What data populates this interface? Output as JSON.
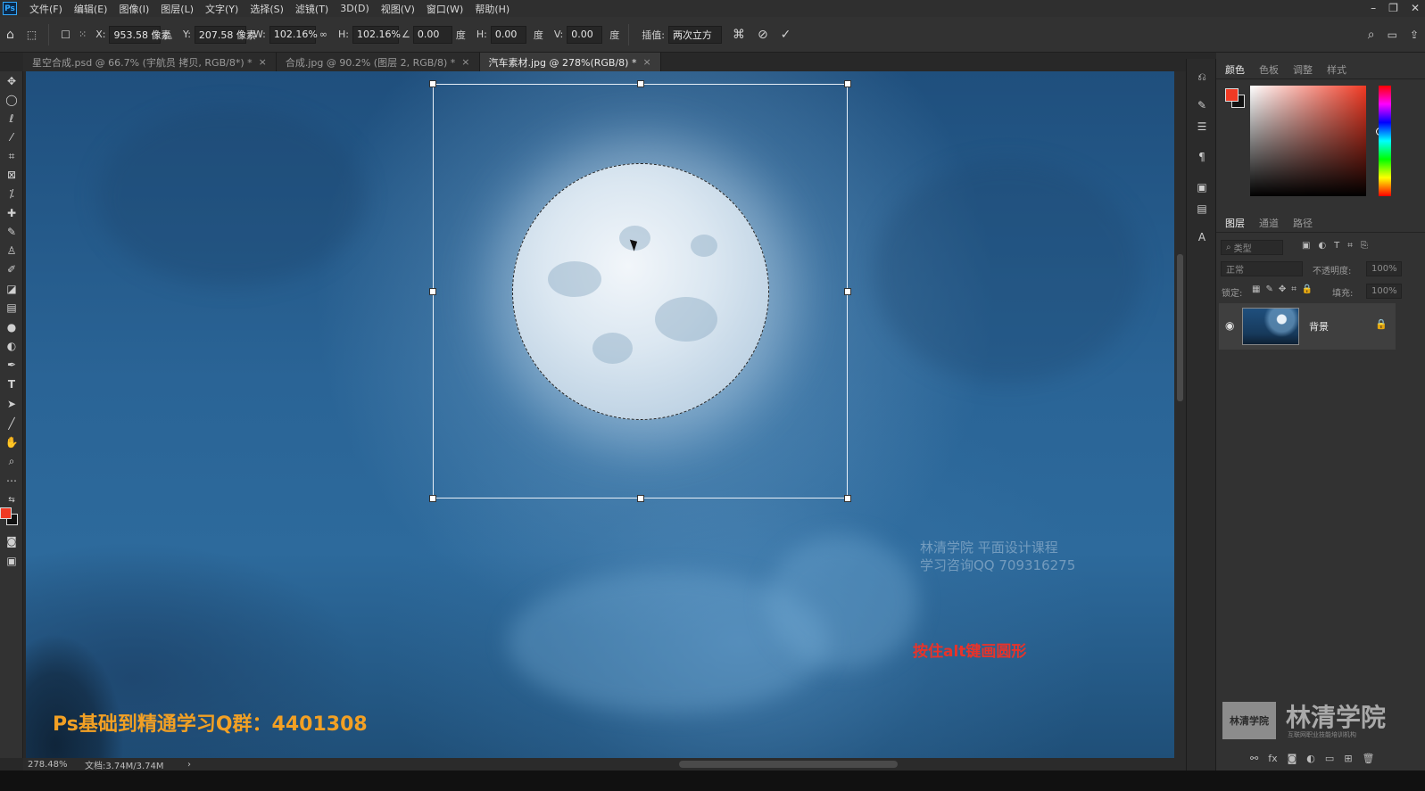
{
  "app": {
    "logo": "Ps",
    "menu": [
      "文件(F)",
      "编辑(E)",
      "图像(I)",
      "图层(L)",
      "文字(Y)",
      "选择(S)",
      "滤镜(T)",
      "3D(D)",
      "视图(V)",
      "窗口(W)",
      "帮助(H)"
    ],
    "window_controls": [
      "–",
      "❐",
      "✕"
    ]
  },
  "options": {
    "x_label": "X:",
    "x_value": "953.58 像素",
    "y_label": "Y:",
    "y_value": "207.58 像素",
    "w_label": "W:",
    "w_value": "102.16%",
    "h_label": "H:",
    "h_value": "102.16%",
    "angle_value": "0.00",
    "angle_unit": "度",
    "hskew_label": "H:",
    "hskew_value": "0.00",
    "hskew_unit": "度",
    "vskew_label": "V:",
    "vskew_value": "0.00",
    "vskew_unit": "度",
    "interp_label": "插值:",
    "interp_value": "两次立方"
  },
  "tabs": [
    {
      "label": "星空合成.psd @ 66.7% (宇航员 拷贝, RGB/8*) *",
      "close": "×"
    },
    {
      "label": "合成.jpg @ 90.2% (图层 2, RGB/8) *",
      "close": "×"
    },
    {
      "label": "汽车素材.jpg @ 278%(RGB/8) *",
      "close": "×"
    }
  ],
  "canvas": {
    "watermark_line1": "林清学院  平面设计课程",
    "watermark_line2": "学习咨询QQ 709316275",
    "red_note": "按住alt键画圆形",
    "orange_note": "Ps基础到精通学习Q群：4401308"
  },
  "status": {
    "zoom": "278.48%",
    "doc": "文档:3.74M/3.74M",
    "arrow": "›"
  },
  "color_panel": {
    "tabs": [
      "颜色",
      "色板",
      "调整",
      "样式"
    ],
    "foreground": "#f03a24",
    "background": "#111111"
  },
  "layers_panel": {
    "tabs": [
      "图层",
      "通道",
      "路径"
    ],
    "filter_placeholder": "类型",
    "blend_mode": "正常",
    "opacity_label": "不透明度:",
    "opacity_value": "100%",
    "lock_label": "锁定:",
    "fill_label": "填充:",
    "fill_value": "100%",
    "layers": [
      {
        "name": "背景",
        "visible": true,
        "locked": true
      }
    ]
  },
  "brand": {
    "seal": "林清学院",
    "name": "林清学院",
    "tagline": "互联网职业技能培训机构"
  },
  "colors": {
    "accent_red": "#e8332a",
    "accent_orange": "#f2a024"
  }
}
